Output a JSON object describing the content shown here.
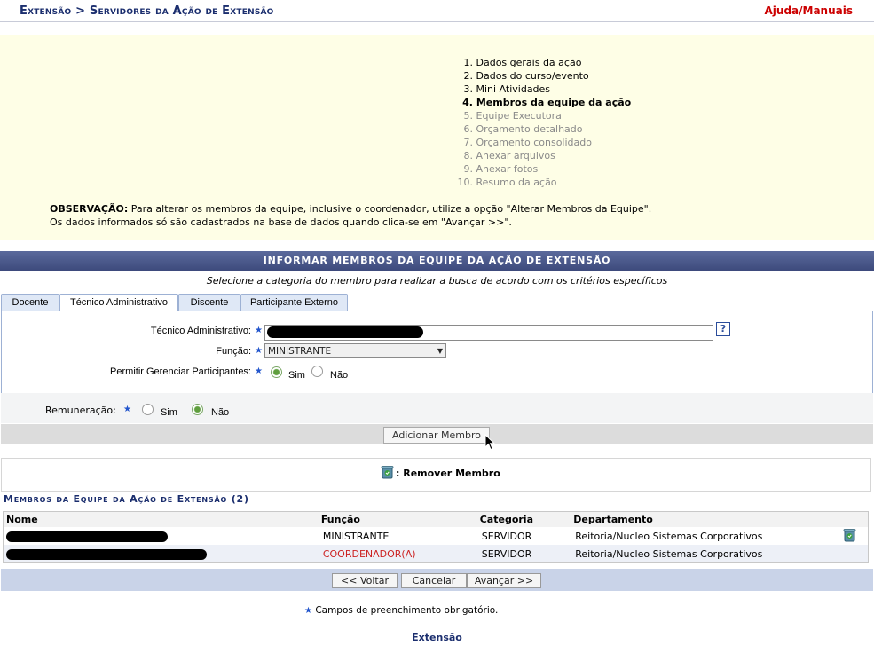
{
  "header": {
    "breadcrumb_root": "Extensão",
    "breadcrumb_sep": ">",
    "breadcrumb_page": "Servidores da Ação de Extensão",
    "help_link": "Ajuda/Manuais"
  },
  "steps": [
    {
      "num": "1.",
      "label": "Dados gerais da ação",
      "state": "done"
    },
    {
      "num": "2.",
      "label": "Dados do curso/evento",
      "state": "done"
    },
    {
      "num": "3.",
      "label": "Mini Atividades",
      "state": "done"
    },
    {
      "num": "4.",
      "label": "Membros da equipe da ação",
      "state": "current"
    },
    {
      "num": "5.",
      "label": "Equipe Executora",
      "state": "pending"
    },
    {
      "num": "6.",
      "label": "Orçamento detalhado",
      "state": "pending"
    },
    {
      "num": "7.",
      "label": "Orçamento consolidado",
      "state": "pending"
    },
    {
      "num": "8.",
      "label": "Anexar arquivos",
      "state": "pending"
    },
    {
      "num": "9.",
      "label": "Anexar fotos",
      "state": "pending"
    },
    {
      "num": "10.",
      "label": "Resumo da ação",
      "state": "pending"
    }
  ],
  "observation": {
    "label": "OBSERVAÇÃO:",
    "line1": "Para alterar os membros da equipe, inclusive o coordenador, utilize a opção \"Alterar Membros da Equipe\".",
    "line2": "Os dados informados só são cadastrados na base de dados quando clica-se em \"Avançar >>\"."
  },
  "section": {
    "title": "Informar Membros da Equipe da Ação de Extensão",
    "subtitle": "Selecione a categoria do membro para realizar a busca de acordo com os critérios específicos"
  },
  "tabs": [
    {
      "label": "Docente",
      "active": false
    },
    {
      "label": "Técnico Administrativo",
      "active": true
    },
    {
      "label": "Discente",
      "active": false
    },
    {
      "label": "Participante Externo",
      "active": false
    }
  ],
  "form": {
    "tecnico_label": "Técnico Administrativo:",
    "tecnico_help": "?",
    "funcao_label": "Função:",
    "funcao_value": "MINISTRANTE",
    "permitir_label": "Permitir Gerenciar Participantes:",
    "permitir_sim": "Sim",
    "permitir_nao": "Não",
    "remuneracao_label": "Remuneração:",
    "remuneracao_sim": "Sim",
    "remuneracao_nao": "Não",
    "add_button": "Adicionar Membro",
    "required_star": "★"
  },
  "legend": {
    "remove_label": ": Remover Membro",
    "icon": "trash-icon"
  },
  "members": {
    "title": "Membros da Equipe da Ação de Extensão (2)",
    "columns": [
      "Nome",
      "Função",
      "Categoria",
      "Departamento"
    ],
    "rows": [
      {
        "funcao": "MINISTRANTE",
        "categoria": "SERVIDOR",
        "departamento": "Reitoria/Nucleo Sistemas Corporativos",
        "removable": true
      },
      {
        "funcao": "COORDENADOR(A)",
        "categoria": "SERVIDOR",
        "departamento": "Reitoria/Nucleo Sistemas Corporativos",
        "removable": false
      }
    ]
  },
  "nav": {
    "back": "<< Voltar",
    "cancel": "Cancelar",
    "next": "Avançar >>"
  },
  "footer": {
    "required_note": "Campos de preenchimento obrigatório.",
    "link": "Extensão"
  },
  "colors": {
    "title_blue": "#1b2e6e",
    "help_red": "#cc0000",
    "info_bg": "#fefee6",
    "section_bar": "#3d4a7c"
  }
}
